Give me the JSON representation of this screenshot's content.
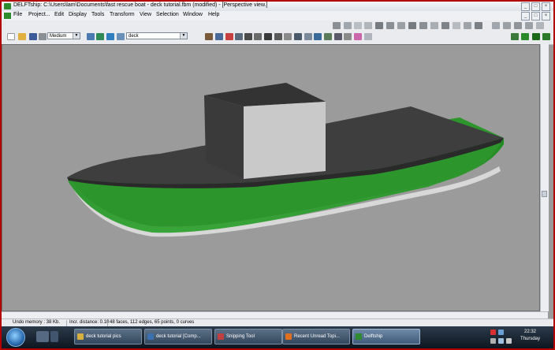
{
  "window": {
    "title": "DELFTship: C:\\Users\\lam\\Documents\\fast rescue boat - deck tutorial.fbm (modified) - [Perspective view.]"
  },
  "menu": [
    "File",
    "Project...",
    "Edit",
    "Display",
    "Tools",
    "Transform",
    "View",
    "Selection",
    "Window",
    "Help"
  ],
  "toolbar": {
    "precision_value": "Medium",
    "layer_value": "deck"
  },
  "status": {
    "undo": "Undo memory : 38 Kb.",
    "incr": "Incr. distance: 0.10",
    "counts": "48 faces, 112 edges, 65 points, 0 curves"
  },
  "taskbar": {
    "items": [
      "deck tutorial pics",
      "deck tutorial [Comp...",
      "Snipping Tool",
      "Recent Unread Topi...",
      "Delftship"
    ],
    "clock_time": "22:32",
    "clock_day": "Thursday"
  },
  "colors": {
    "hull_green": "#2f9a2f",
    "deck": "#3e3e3e",
    "cabin_front": "#c9c9c9",
    "viewport_bg": "#9b9b9b",
    "frame_red": "#b00000"
  }
}
